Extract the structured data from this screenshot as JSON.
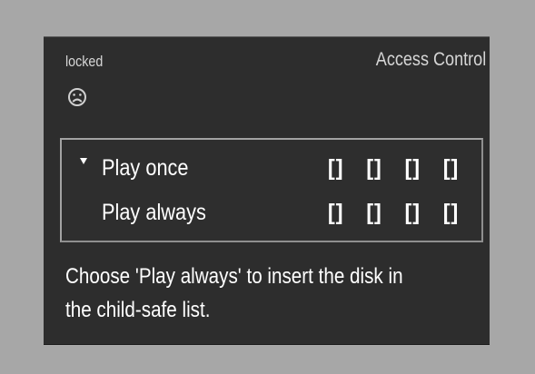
{
  "screen": {
    "status_label": "locked",
    "status_icon": "sad-face-icon",
    "title": "Access Control"
  },
  "menu": {
    "items": [
      {
        "label": "Play once",
        "selected": true,
        "code_slots": [
          "[]",
          "[]",
          "[]",
          "[]"
        ]
      },
      {
        "label": "Play always",
        "selected": false,
        "code_slots": [
          "[]",
          "[]",
          "[]",
          "[]"
        ]
      }
    ]
  },
  "help": {
    "line_1": "Choose 'Play always' to insert the disk in",
    "line_2": "the child-safe list."
  }
}
